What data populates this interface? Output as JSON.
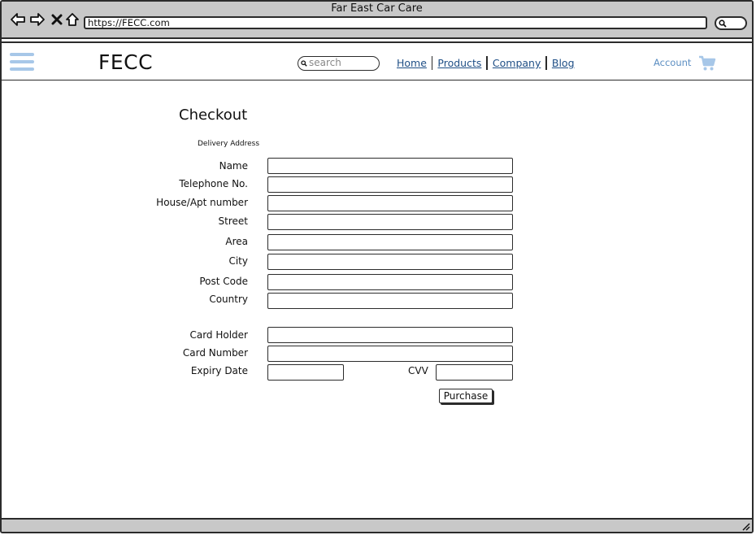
{
  "window": {
    "title": "Far East Car Care"
  },
  "browser": {
    "url": "https://FECC.com",
    "icons": [
      "back-arrow-icon",
      "forward-arrow-icon",
      "close-icon",
      "home-icon",
      "search-icon"
    ]
  },
  "header": {
    "logo": "FECC",
    "search_placeholder": "search",
    "nav": [
      {
        "label": "Home"
      },
      {
        "label": "Products"
      },
      {
        "label": "Company"
      },
      {
        "label": "Blog"
      }
    ],
    "account_label": "Account",
    "accent_color": "#a7c7e8",
    "link_color": "#1f4f86"
  },
  "checkout": {
    "title": "Checkout",
    "section_label": "Delivery Address",
    "delivery_fields": [
      {
        "label": "Name",
        "value": ""
      },
      {
        "label": "Telephone No.",
        "value": ""
      },
      {
        "label": "House/Apt number",
        "value": ""
      },
      {
        "label": "Street",
        "value": ""
      },
      {
        "label": "Area",
        "value": ""
      },
      {
        "label": "City",
        "value": ""
      },
      {
        "label": "Post Code",
        "value": ""
      },
      {
        "label": "Country",
        "value": ""
      }
    ],
    "payment_fields": [
      {
        "label": "Card Holder",
        "value": ""
      },
      {
        "label": "Card Number",
        "value": ""
      },
      {
        "label": "Expiry Date",
        "value": ""
      }
    ],
    "cvv_label": "CVV",
    "purchase_label": "Purchase"
  }
}
